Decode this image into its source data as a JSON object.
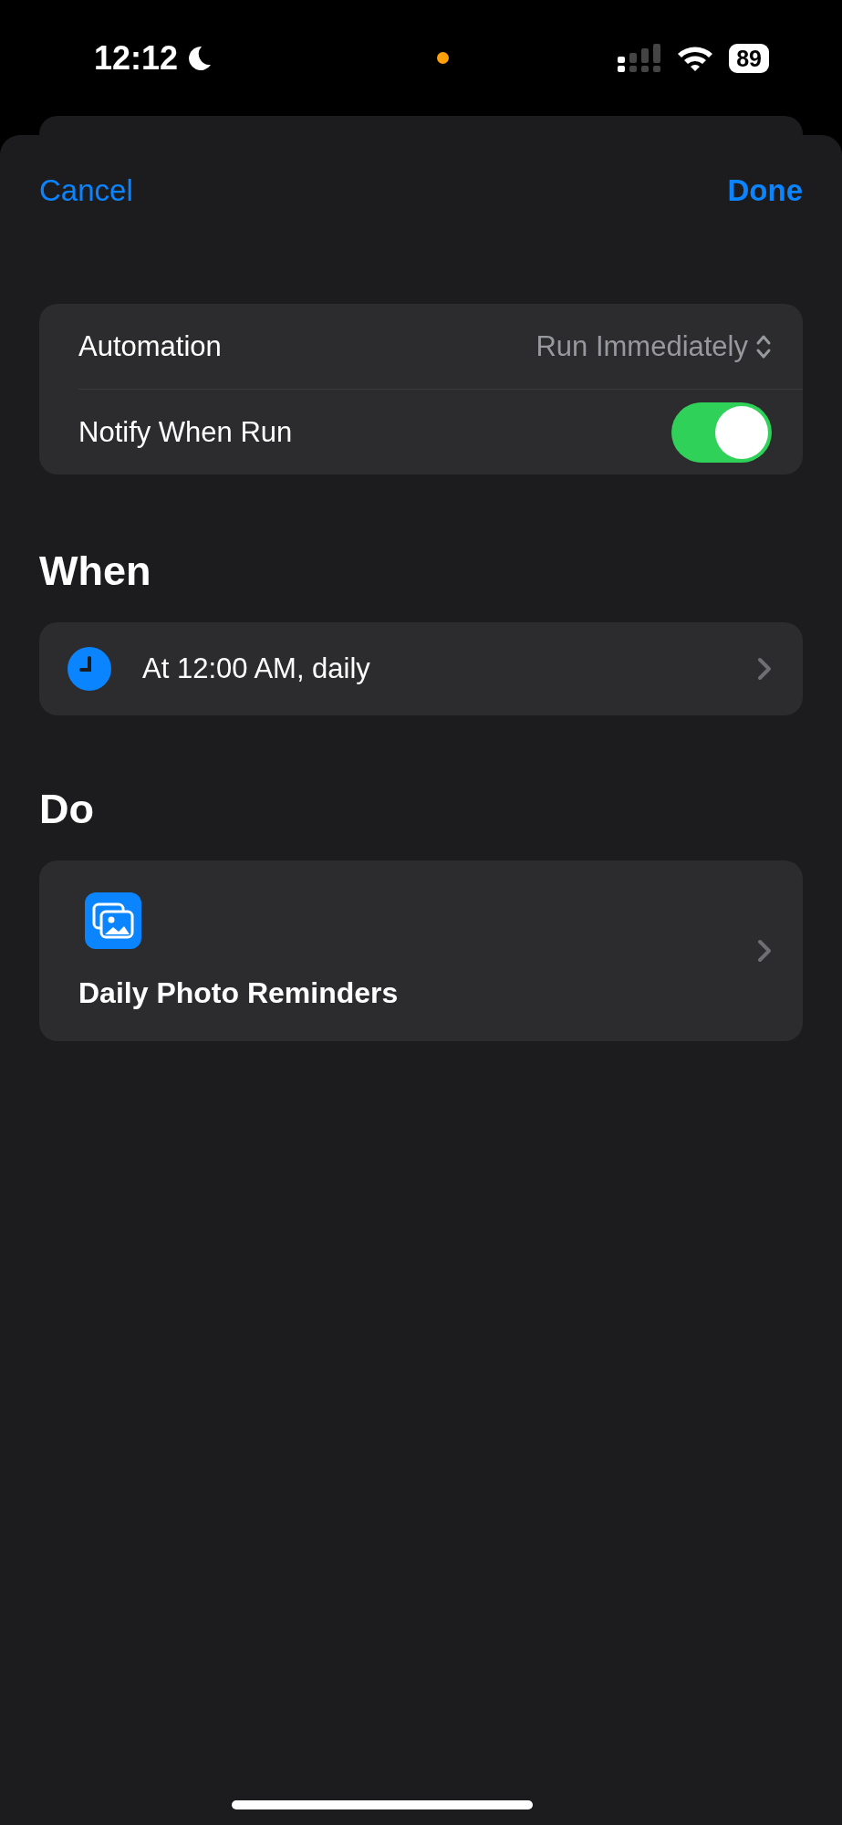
{
  "status_bar": {
    "time": "12:12",
    "focus_moon": true,
    "battery": "89"
  },
  "nav": {
    "cancel": "Cancel",
    "done": "Done"
  },
  "settings": [
    {
      "kind": "picker",
      "label": "Automation",
      "value": "Run Immediately"
    },
    {
      "kind": "toggle",
      "label": "Notify When Run",
      "on": true
    }
  ],
  "when": {
    "heading": "When",
    "trigger": "At 12:00 AM, daily"
  },
  "do": {
    "heading": "Do",
    "shortcut": "Daily Photo Reminders"
  }
}
